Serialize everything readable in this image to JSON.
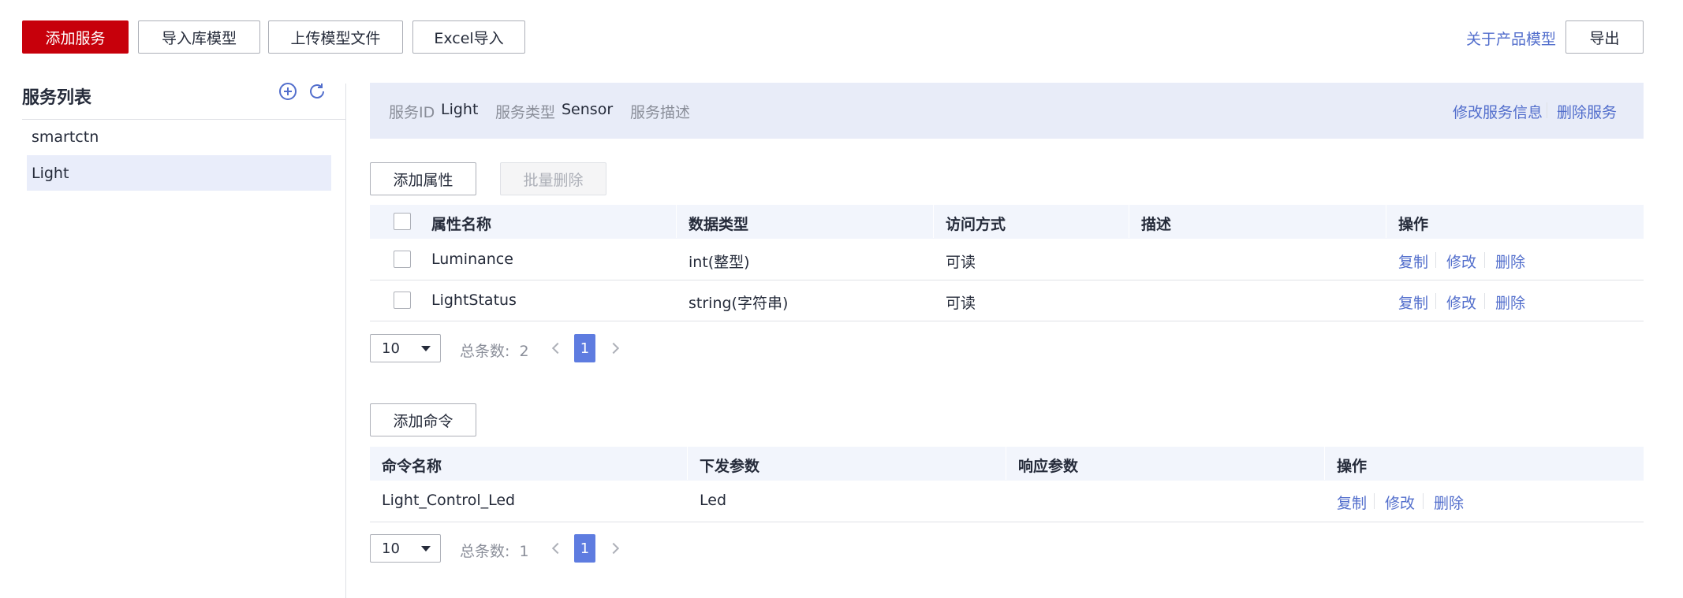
{
  "toolbar": {
    "add_service": "添加服务",
    "import_library": "导入库模型",
    "upload_model": "上传模型文件",
    "excel_import": "Excel导入",
    "about_model": "关于产品模型",
    "export": "导出"
  },
  "sidebar": {
    "title": "服务列表",
    "items": [
      {
        "label": "smartctn"
      },
      {
        "label": "Light",
        "selected": true
      }
    ]
  },
  "service_info": {
    "id_label": "服务ID",
    "id_value": "Light",
    "type_label": "服务类型",
    "type_value": "Sensor",
    "desc_label": "服务描述",
    "modify": "修改服务信息",
    "delete": "删除服务"
  },
  "properties": {
    "add_button": "添加属性",
    "batch_delete": "批量删除",
    "columns": [
      "属性名称",
      "数据类型",
      "访问方式",
      "描述",
      "操作"
    ],
    "rows": [
      {
        "name": "Luminance",
        "type": "int(整型)",
        "access": "可读",
        "desc": ""
      },
      {
        "name": "LightStatus",
        "type": "string(字符串)",
        "access": "可读",
        "desc": ""
      }
    ],
    "actions": [
      "复制",
      "修改",
      "删除"
    ],
    "pagination": {
      "page_size": "10",
      "total_label": "总条数:",
      "total": "2",
      "current_page": "1"
    }
  },
  "commands": {
    "add_button": "添加命令",
    "columns": [
      "命令名称",
      "下发参数",
      "响应参数",
      "操作"
    ],
    "rows": [
      {
        "name": "Light_Control_Led",
        "params": "Led",
        "response": ""
      }
    ],
    "actions": [
      "复制",
      "修改",
      "删除"
    ],
    "pagination": {
      "page_size": "10",
      "total_label": "总条数:",
      "total": "1",
      "current_page": "1"
    }
  },
  "colors": {
    "primary": "#c7000b",
    "link": "#526ecc",
    "info_bg": "#e8ecf8",
    "table_header_bg": "#f2f5fc",
    "selected_bg": "#e9edfa",
    "page_active": "#5e7ce0"
  }
}
